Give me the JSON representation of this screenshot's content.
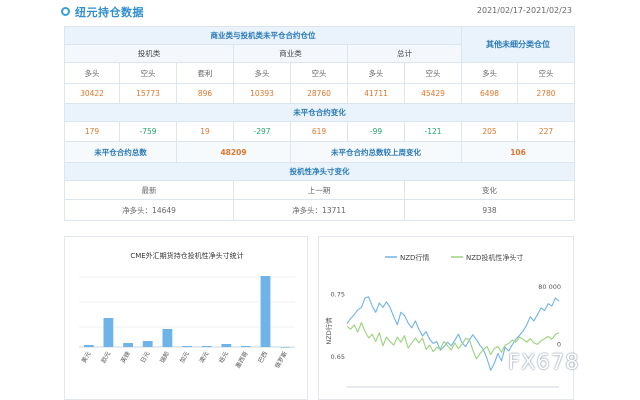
{
  "header": {
    "title": "纽元持仓数据",
    "date_range": "2021/02/17-2021/02/23"
  },
  "table": {
    "group_title": "商业类与投机类未平仓合约仓位",
    "other_title": "其他未细分类仓位",
    "sub_groups": [
      "投机类",
      "商业类",
      "总计"
    ],
    "col_headers": [
      "多头",
      "空头",
      "套利",
      "多头",
      "空头",
      "多头",
      "空头",
      "多头",
      "空头"
    ],
    "values": [
      "30422",
      "15773",
      "896",
      "10393",
      "28760",
      "41711",
      "45429",
      "6498",
      "2780"
    ],
    "change_title": "未平仓合约变化",
    "changes": [
      "179",
      "-759",
      "19",
      "-297",
      "619",
      "-99",
      "-121",
      "205",
      "227"
    ],
    "total_label": "未平仓合约总数",
    "total_value": "48209",
    "total_change_label": "未平仓合约总数较上周变化",
    "total_change_value": "106",
    "spec_title": "投机性净头寸变化",
    "spec_headers": [
      "最新",
      "上一期",
      "变化"
    ],
    "spec_latest": "净多头：14649",
    "spec_prev": "净多头：13711",
    "spec_change": "938"
  },
  "chart_data": [
    {
      "type": "bar",
      "title": "CME外汇期货持仓投机性净头寸统计",
      "categories": [
        "美元",
        "欧元",
        "英镑",
        "日元",
        "瑞郎",
        "加元",
        "澳元",
        "纽元",
        "墨西哥",
        "巴西",
        "俄罗斯"
      ],
      "values": [
        2,
        29,
        4,
        6,
        18,
        1,
        1,
        3,
        1,
        71,
        0
      ],
      "colors": {
        "bar": "#6fb4e8"
      }
    },
    {
      "type": "line",
      "title": "",
      "legend": [
        "NZD行情",
        "NZD投机性净头寸"
      ],
      "ylabel_left": "NZD行情",
      "y_left_ticks": [
        "0.75",
        "0.65"
      ],
      "y_right_ticks": [
        "80 000",
        "0"
      ],
      "y_left_range": [
        0.6,
        0.78
      ],
      "y_right_range": [
        -60000,
        95000
      ],
      "series": [
        {
          "name": "NZD行情",
          "color": "#6fb4e8",
          "values": [
            0.702,
            0.71,
            0.716,
            0.724,
            0.728,
            0.743,
            0.745,
            0.73,
            0.72,
            0.735,
            0.728,
            0.737,
            0.728,
            0.713,
            0.7,
            0.72,
            0.715,
            0.703,
            0.695,
            0.706,
            0.693,
            0.682,
            0.689,
            0.677,
            0.67,
            0.673,
            0.659,
            0.665,
            0.672,
            0.666,
            0.675,
            0.685,
            0.671,
            0.665,
            0.675,
            0.684,
            0.676,
            0.667,
            0.66,
            0.645,
            0.627,
            0.638,
            0.654,
            0.642,
            0.664,
            0.658,
            0.668,
            0.677,
            0.683,
            0.69,
            0.7,
            0.713,
            0.706,
            0.716,
            0.727,
            0.723,
            0.734,
            0.73,
            0.743,
            0.738
          ]
        },
        {
          "name": "NZD投机性净头寸",
          "color": "#9bd27c",
          "values": [
            24000,
            20000,
            26000,
            16000,
            29000,
            17000,
            8000,
            13000,
            3000,
            15000,
            -3000,
            9000,
            3000,
            -2000,
            9000,
            2000,
            11000,
            -6000,
            1000,
            8000,
            1000,
            8000,
            -8000,
            -2000,
            -11000,
            -5000,
            -7000,
            3000,
            -3000,
            -9000,
            1000,
            -7000,
            -1000,
            7000,
            6000,
            -9000,
            -21000,
            -14000,
            -8000,
            -4000,
            -15000,
            -7000,
            -4000,
            -12000,
            -2000,
            0,
            5000,
            2000,
            9000,
            6000,
            2000,
            7000,
            1000,
            -1000,
            4000,
            7000,
            10000,
            6000,
            13000,
            15000
          ]
        }
      ]
    }
  ],
  "watermark": "FX678"
}
